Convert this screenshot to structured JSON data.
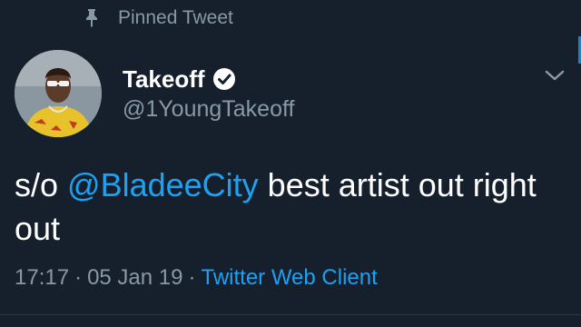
{
  "pinned": {
    "label": "Pinned Tweet",
    "icon": "pin-icon"
  },
  "author": {
    "display_name": "Takeoff",
    "handle": "@1YoungTakeoff",
    "verified": true,
    "avatar_icon": "avatar"
  },
  "tweet": {
    "prefix": "s/o ",
    "mention": "@BladeeCity",
    "suffix": " best artist out right out"
  },
  "meta": {
    "time": "17:17",
    "separator": "·",
    "date": "05 Jan 19",
    "client": "Twitter Web Client"
  },
  "colors": {
    "background": "#16202c",
    "text": "#ffffff",
    "muted": "#8899a6",
    "accent": "#1da1f2"
  }
}
